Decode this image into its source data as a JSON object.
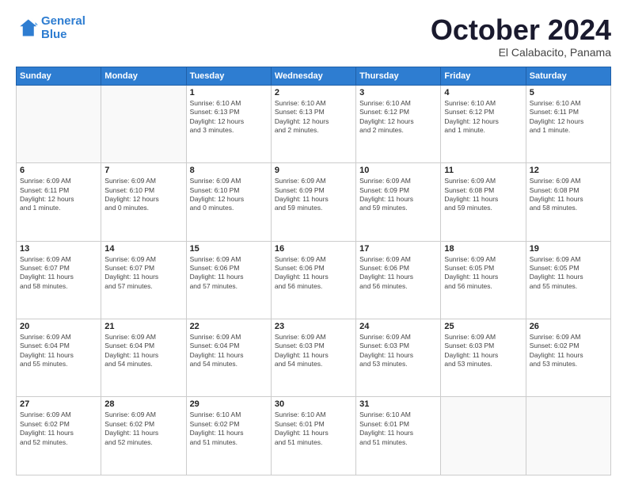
{
  "logo": {
    "line1": "General",
    "line2": "Blue"
  },
  "title": "October 2024",
  "subtitle": "El Calabacito, Panama",
  "weekdays": [
    "Sunday",
    "Monday",
    "Tuesday",
    "Wednesday",
    "Thursday",
    "Friday",
    "Saturday"
  ],
  "weeks": [
    [
      {
        "day": "",
        "info": ""
      },
      {
        "day": "",
        "info": ""
      },
      {
        "day": "1",
        "info": "Sunrise: 6:10 AM\nSunset: 6:13 PM\nDaylight: 12 hours\nand 3 minutes."
      },
      {
        "day": "2",
        "info": "Sunrise: 6:10 AM\nSunset: 6:13 PM\nDaylight: 12 hours\nand 2 minutes."
      },
      {
        "day": "3",
        "info": "Sunrise: 6:10 AM\nSunset: 6:12 PM\nDaylight: 12 hours\nand 2 minutes."
      },
      {
        "day": "4",
        "info": "Sunrise: 6:10 AM\nSunset: 6:12 PM\nDaylight: 12 hours\nand 1 minute."
      },
      {
        "day": "5",
        "info": "Sunrise: 6:10 AM\nSunset: 6:11 PM\nDaylight: 12 hours\nand 1 minute."
      }
    ],
    [
      {
        "day": "6",
        "info": "Sunrise: 6:09 AM\nSunset: 6:11 PM\nDaylight: 12 hours\nand 1 minute."
      },
      {
        "day": "7",
        "info": "Sunrise: 6:09 AM\nSunset: 6:10 PM\nDaylight: 12 hours\nand 0 minutes."
      },
      {
        "day": "8",
        "info": "Sunrise: 6:09 AM\nSunset: 6:10 PM\nDaylight: 12 hours\nand 0 minutes."
      },
      {
        "day": "9",
        "info": "Sunrise: 6:09 AM\nSunset: 6:09 PM\nDaylight: 11 hours\nand 59 minutes."
      },
      {
        "day": "10",
        "info": "Sunrise: 6:09 AM\nSunset: 6:09 PM\nDaylight: 11 hours\nand 59 minutes."
      },
      {
        "day": "11",
        "info": "Sunrise: 6:09 AM\nSunset: 6:08 PM\nDaylight: 11 hours\nand 59 minutes."
      },
      {
        "day": "12",
        "info": "Sunrise: 6:09 AM\nSunset: 6:08 PM\nDaylight: 11 hours\nand 58 minutes."
      }
    ],
    [
      {
        "day": "13",
        "info": "Sunrise: 6:09 AM\nSunset: 6:07 PM\nDaylight: 11 hours\nand 58 minutes."
      },
      {
        "day": "14",
        "info": "Sunrise: 6:09 AM\nSunset: 6:07 PM\nDaylight: 11 hours\nand 57 minutes."
      },
      {
        "day": "15",
        "info": "Sunrise: 6:09 AM\nSunset: 6:06 PM\nDaylight: 11 hours\nand 57 minutes."
      },
      {
        "day": "16",
        "info": "Sunrise: 6:09 AM\nSunset: 6:06 PM\nDaylight: 11 hours\nand 56 minutes."
      },
      {
        "day": "17",
        "info": "Sunrise: 6:09 AM\nSunset: 6:06 PM\nDaylight: 11 hours\nand 56 minutes."
      },
      {
        "day": "18",
        "info": "Sunrise: 6:09 AM\nSunset: 6:05 PM\nDaylight: 11 hours\nand 56 minutes."
      },
      {
        "day": "19",
        "info": "Sunrise: 6:09 AM\nSunset: 6:05 PM\nDaylight: 11 hours\nand 55 minutes."
      }
    ],
    [
      {
        "day": "20",
        "info": "Sunrise: 6:09 AM\nSunset: 6:04 PM\nDaylight: 11 hours\nand 55 minutes."
      },
      {
        "day": "21",
        "info": "Sunrise: 6:09 AM\nSunset: 6:04 PM\nDaylight: 11 hours\nand 54 minutes."
      },
      {
        "day": "22",
        "info": "Sunrise: 6:09 AM\nSunset: 6:04 PM\nDaylight: 11 hours\nand 54 minutes."
      },
      {
        "day": "23",
        "info": "Sunrise: 6:09 AM\nSunset: 6:03 PM\nDaylight: 11 hours\nand 54 minutes."
      },
      {
        "day": "24",
        "info": "Sunrise: 6:09 AM\nSunset: 6:03 PM\nDaylight: 11 hours\nand 53 minutes."
      },
      {
        "day": "25",
        "info": "Sunrise: 6:09 AM\nSunset: 6:03 PM\nDaylight: 11 hours\nand 53 minutes."
      },
      {
        "day": "26",
        "info": "Sunrise: 6:09 AM\nSunset: 6:02 PM\nDaylight: 11 hours\nand 53 minutes."
      }
    ],
    [
      {
        "day": "27",
        "info": "Sunrise: 6:09 AM\nSunset: 6:02 PM\nDaylight: 11 hours\nand 52 minutes."
      },
      {
        "day": "28",
        "info": "Sunrise: 6:09 AM\nSunset: 6:02 PM\nDaylight: 11 hours\nand 52 minutes."
      },
      {
        "day": "29",
        "info": "Sunrise: 6:10 AM\nSunset: 6:02 PM\nDaylight: 11 hours\nand 51 minutes."
      },
      {
        "day": "30",
        "info": "Sunrise: 6:10 AM\nSunset: 6:01 PM\nDaylight: 11 hours\nand 51 minutes."
      },
      {
        "day": "31",
        "info": "Sunrise: 6:10 AM\nSunset: 6:01 PM\nDaylight: 11 hours\nand 51 minutes."
      },
      {
        "day": "",
        "info": ""
      },
      {
        "day": "",
        "info": ""
      }
    ]
  ]
}
